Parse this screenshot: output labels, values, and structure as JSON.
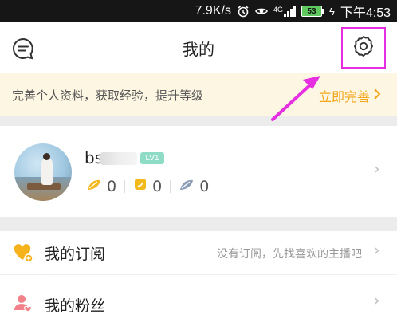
{
  "status_bar": {
    "net_speed": "7.9K/s",
    "network_type": "4G",
    "battery_level": "53",
    "time": "下午4:53",
    "icons": [
      "alarm-icon",
      "eye-icon",
      "signal-icon",
      "battery-icon",
      "charging-icon"
    ]
  },
  "header": {
    "title": "我的",
    "message_icon": "message-icon",
    "settings_icon": "gear-icon"
  },
  "banner": {
    "text": "完善个人资料，获取经验，提升等级",
    "link": "立即完善"
  },
  "profile": {
    "name_visible": "bs",
    "level": "LV1",
    "stats": [
      {
        "icon": "gold-leaf-icon",
        "value": "0"
      },
      {
        "icon": "gold-note-icon",
        "value": "0"
      },
      {
        "icon": "feather-icon",
        "value": "0"
      }
    ]
  },
  "menu": [
    {
      "label": "我的订阅",
      "hint": "没有订阅，先找喜欢的主播吧",
      "icon": "heart-plus-icon"
    },
    {
      "label": "我的粉丝",
      "hint": "",
      "icon": "fans-icon"
    }
  ],
  "colors": {
    "accent": "#f3a51a",
    "annotation": "#e52fe0",
    "level_badge": "#8fdcc6",
    "banner_bg": "#fdf6e3"
  }
}
